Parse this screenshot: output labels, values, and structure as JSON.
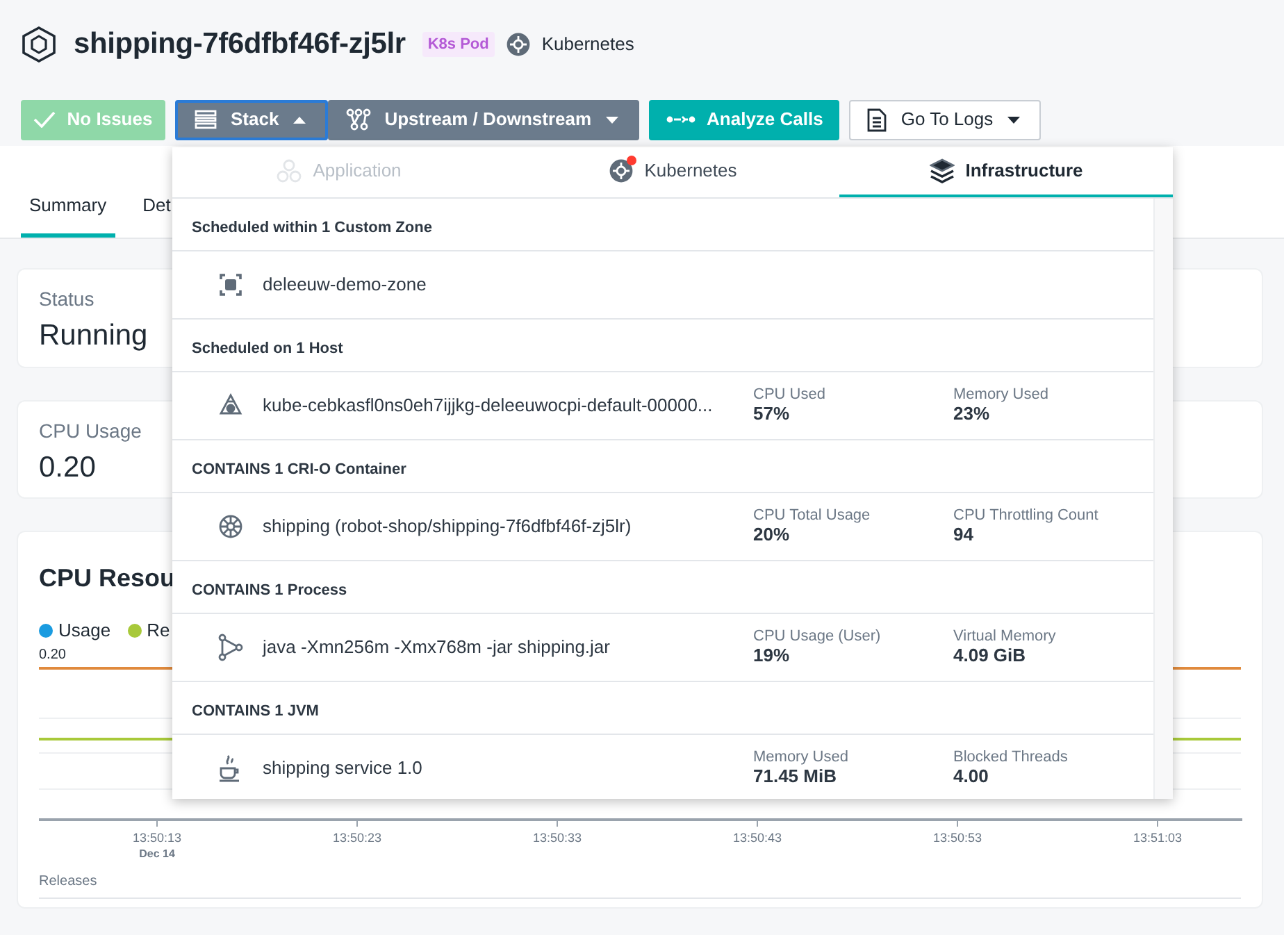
{
  "header": {
    "title": "shipping-7f6dfbf46f-zj5lr",
    "badge": "K8s Pod",
    "platform": "Kubernetes"
  },
  "actions": [
    {
      "kind": "status",
      "label": "No Issues",
      "disabled": true
    },
    {
      "kind": "menu",
      "label": "Stack",
      "expanded": true
    },
    {
      "kind": "menu",
      "label": "Upstream / Downstream",
      "expanded": false
    },
    {
      "kind": "primary",
      "label": "Analyze Calls"
    },
    {
      "kind": "outline",
      "label": "Go To Logs",
      "expanded": false
    }
  ],
  "page_tabs": [
    {
      "label": "Summary",
      "selected": true
    },
    {
      "label": "Det",
      "selected": false
    }
  ],
  "cards": [
    {
      "label": "Status",
      "value": "Running"
    },
    {
      "label": "CPU Usage",
      "value": "0.20"
    }
  ],
  "chart": {
    "title": "CPU Resou",
    "legend": [
      {
        "label": "Usage",
        "color": "#1a9be0"
      },
      {
        "label": "Re",
        "color": "#a8c93a"
      }
    ],
    "y_label": "0.20",
    "x_ticks": [
      {
        "time": "13:50:13",
        "date": "Dec 14"
      },
      {
        "time": "13:50:23"
      },
      {
        "time": "13:50:33"
      },
      {
        "time": "13:50:43"
      },
      {
        "time": "13:50:53"
      },
      {
        "time": "13:51:03"
      }
    ],
    "releases": "Releases"
  },
  "stack_menu": {
    "tabs": [
      {
        "label": "Application",
        "selected": false,
        "disabled": true,
        "alert": false
      },
      {
        "label": "Kubernetes",
        "selected": false,
        "disabled": false,
        "alert": true
      },
      {
        "label": "Infrastructure",
        "selected": true,
        "disabled": false,
        "alert": false
      }
    ],
    "sections": [
      {
        "heading": "Scheduled within 1 Custom Zone",
        "items": [
          {
            "kind": "zone",
            "name": "deleeuw-demo-zone"
          }
        ]
      },
      {
        "heading": "Scheduled on 1 Host",
        "items": [
          {
            "kind": "host",
            "name": "kube-cebkasfl0ns0eh7ijjkg-deleeuwocpi-default-00000...",
            "metrics": [
              {
                "label": "CPU Used",
                "value": "57%"
              },
              {
                "label": "Memory Used",
                "value": "23%"
              }
            ]
          }
        ]
      },
      {
        "heading": "CONTAINS 1 CRI-O Container",
        "items": [
          {
            "kind": "container",
            "name": "shipping (robot-shop/shipping-7f6dfbf46f-zj5lr)",
            "metrics": [
              {
                "label": "CPU Total Usage",
                "value": "20%"
              },
              {
                "label": "CPU Throttling Count",
                "value": "94"
              }
            ]
          }
        ]
      },
      {
        "heading": "CONTAINS 1 Process",
        "items": [
          {
            "kind": "process",
            "name": "java -Xmn256m -Xmx768m -jar shipping.jar",
            "metrics": [
              {
                "label": "CPU Usage (User)",
                "value": "19%"
              },
              {
                "label": "Virtual Memory",
                "value": "4.09 GiB"
              }
            ]
          }
        ]
      },
      {
        "heading": "CONTAINS 1 JVM",
        "items": [
          {
            "kind": "jvm",
            "name": "shipping service 1.0",
            "metrics": [
              {
                "label": "Memory Used",
                "value": "71.45 MiB"
              },
              {
                "label": "Blocked Threads",
                "value": "4.00"
              }
            ]
          }
        ]
      }
    ]
  }
}
